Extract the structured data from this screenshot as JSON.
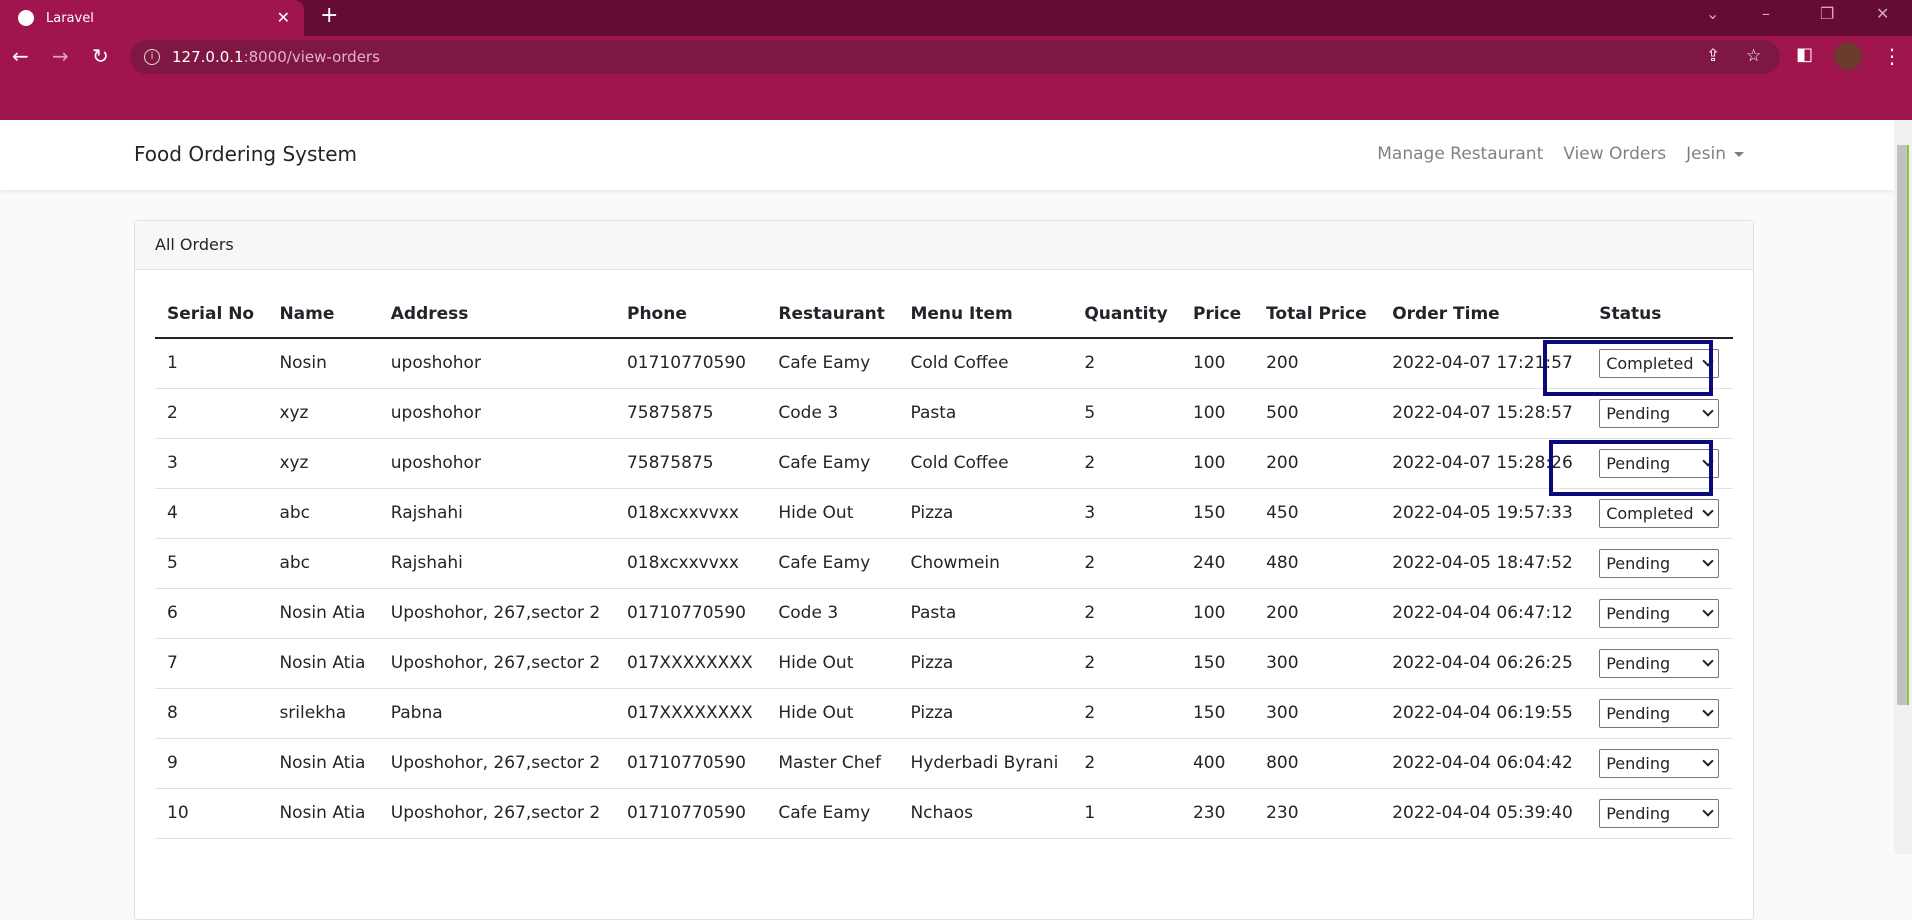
{
  "browser": {
    "tab_title": "Laravel",
    "url_host": "127.0.0.1",
    "url_path": ":8000/view-orders"
  },
  "navbar": {
    "brand": "Food Ordering System",
    "links": [
      "Manage Restaurant",
      "View Orders"
    ],
    "user": "Jesin"
  },
  "card": {
    "title": "All Orders"
  },
  "table": {
    "columns": [
      "Serial No",
      "Name",
      "Address",
      "Phone",
      "Restaurant",
      "Menu Item",
      "Quantity",
      "Price",
      "Total Price",
      "Order Time",
      "Status"
    ],
    "rows": [
      [
        "1",
        "Nosin",
        "uposhohor",
        "01710770590",
        "Cafe Eamy",
        "Cold Coffee",
        "2",
        "100",
        "200",
        "2022-04-07 17:21:57",
        "Completed"
      ],
      [
        "2",
        "xyz",
        "uposhohor",
        "75875875",
        "Code 3",
        "Pasta",
        "5",
        "100",
        "500",
        "2022-04-07 15:28:57",
        "Pending"
      ],
      [
        "3",
        "xyz",
        "uposhohor",
        "75875875",
        "Cafe Eamy",
        "Cold Coffee",
        "2",
        "100",
        "200",
        "2022-04-07 15:28:26",
        "Pending"
      ],
      [
        "4",
        "abc",
        "Rajshahi",
        "018xcxxvvxx",
        "Hide Out",
        "Pizza",
        "3",
        "150",
        "450",
        "2022-04-05 19:57:33",
        "Completed"
      ],
      [
        "5",
        "abc",
        "Rajshahi",
        "018xcxxvvxx",
        "Cafe Eamy",
        "Chowmein",
        "2",
        "240",
        "480",
        "2022-04-05 18:47:52",
        "Pending"
      ],
      [
        "6",
        "Nosin Atia",
        "Uposhohor, 267,sector 2",
        "01710770590",
        "Code 3",
        "Pasta",
        "2",
        "100",
        "200",
        "2022-04-04 06:47:12",
        "Pending"
      ],
      [
        "7",
        "Nosin Atia",
        "Uposhohor, 267,sector 2",
        "017XXXXXXXX",
        "Hide Out",
        "Pizza",
        "2",
        "150",
        "300",
        "2022-04-04 06:26:25",
        "Pending"
      ],
      [
        "8",
        "srilekha",
        "Pabna",
        "017XXXXXXXX",
        "Hide Out",
        "Pizza",
        "2",
        "150",
        "300",
        "2022-04-04 06:19:55",
        "Pending"
      ],
      [
        "9",
        "Nosin Atia",
        "Uposhohor, 267,sector 2",
        "01710770590",
        "Master Chef",
        "Hyderbadi Byrani",
        "2",
        "400",
        "800",
        "2022-04-04 06:04:42",
        "Pending"
      ],
      [
        "10",
        "Nosin Atia",
        "Uposhohor, 267,sector 2",
        "01710770590",
        "Cafe Eamy",
        "Nchaos",
        "1",
        "230",
        "230",
        "2022-04-04 05:39:40",
        "Pending"
      ]
    ]
  },
  "colors": {
    "browser_frame": "#a1154f",
    "tab_strip": "#650c33",
    "highlight": "#0a0a7a"
  }
}
